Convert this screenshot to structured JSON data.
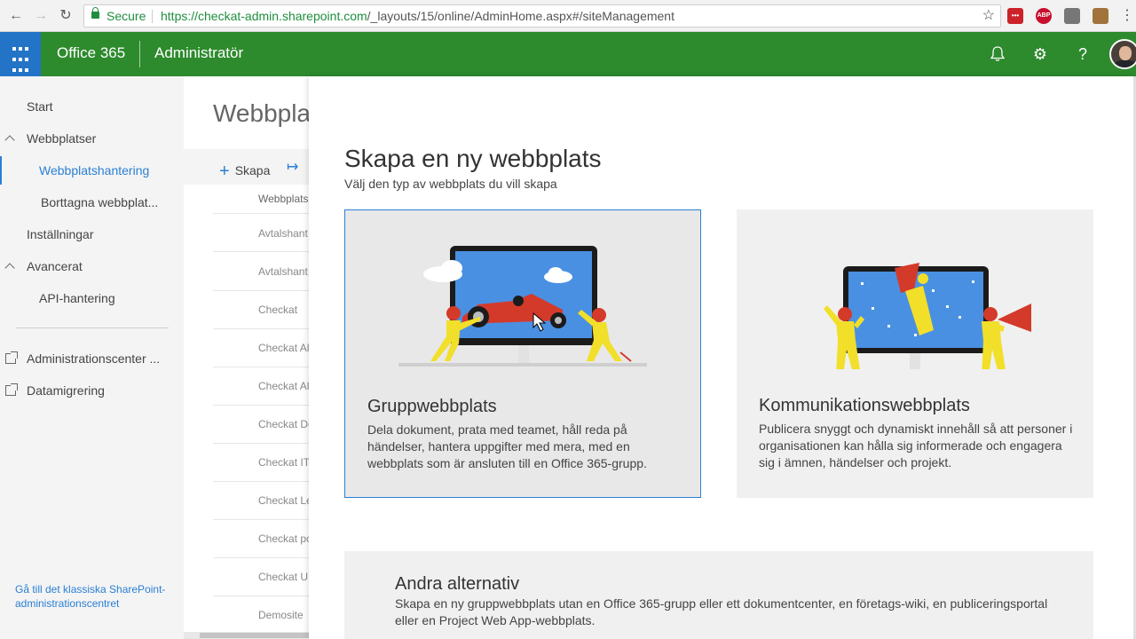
{
  "browser": {
    "secure_label": "Secure",
    "url_host": "https://checkat-admin.sharepoint.com",
    "url_path": "/_layouts/15/online/AdminHome.aspx#/siteManagement",
    "extensions": [
      {
        "name": "lastpass-icon",
        "label": "•••",
        "color": "#cc2229"
      },
      {
        "name": "adblock-icon",
        "label": "ABP",
        "color": "#c8102e"
      },
      {
        "name": "extension-icon",
        "label": "",
        "color": "#777777"
      },
      {
        "name": "box-extension-icon",
        "label": "",
        "color": "#a0743a"
      }
    ]
  },
  "suite": {
    "brand": "Office 365",
    "app_title": "Administratör",
    "accent_color": "#2d8a2d"
  },
  "nav": {
    "start": "Start",
    "sites": "Webbplatser",
    "site_management": "Webbplatshantering",
    "deleted_sites": "Borttagna webbplat...",
    "settings": "Inställningar",
    "advanced": "Avancerat",
    "api": "API-hantering",
    "admin_centers": "Administrationscenter ...",
    "data_migration": "Datamigrering",
    "classic_link": "Gå till det klassiska SharePoint-administrationscentret"
  },
  "background": {
    "title": "Webbplat",
    "create_label": "Skapa",
    "column_header": "Webbplats",
    "rows": [
      "Avtalshant",
      "Avtalshant",
      "Checkat",
      "Checkat Al",
      "Checkat Al",
      "Checkat De",
      "Checkat IT",
      "Checkat Le",
      "Checkat po",
      "Checkat U",
      "Demosite"
    ]
  },
  "panel": {
    "title": "Skapa en ny webbplats",
    "subtitle": "Välj den typ av webbplats du vill skapa",
    "cards": [
      {
        "title": "Gruppwebbplats",
        "description": "Dela dokument, prata med teamet, håll reda på händelser, hantera uppgifter med mera, med en webbplats som är ansluten till en Office 365-grupp."
      },
      {
        "title": "Kommunikationswebbplats",
        "description": "Publicera snyggt och dynamiskt innehåll så att personer i organisationen kan hålla sig informerade och engagera sig i ämnen, händelser och projekt."
      }
    ],
    "other": {
      "title": "Andra alternativ",
      "description": "Skapa en ny gruppwebbplats utan en Office 365-grupp eller ett dokumentcenter, en företags-wiki, en publiceringsportal eller en Project Web App-webbplats."
    }
  }
}
